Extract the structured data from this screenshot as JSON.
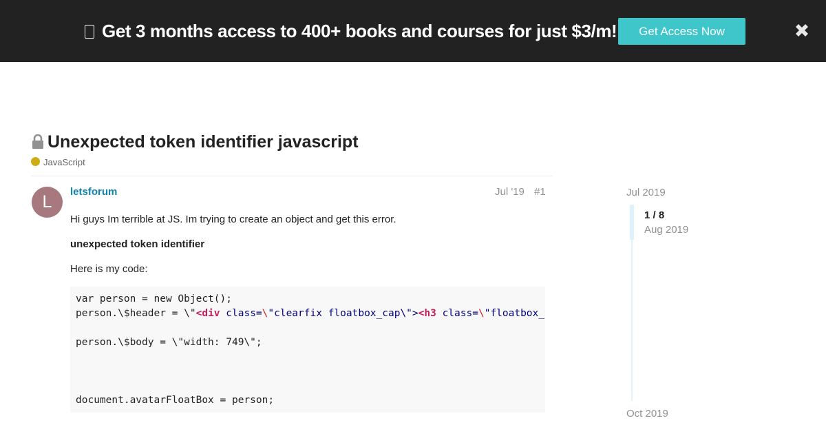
{
  "promo": {
    "emoji_icon": "box-icon",
    "text": "Get 3 months access to 400+ books and courses for just $3/m!",
    "button_label": "Get Access Now",
    "close_icon": "close-icon",
    "bg_color": "#222222",
    "button_color": "#3ec6cb"
  },
  "topic": {
    "title": "Unexpected token identifier javascript",
    "status_icon": "lock-icon",
    "category": "JavaScript",
    "category_color": "#cfac10"
  },
  "post": {
    "avatar_letter": "L",
    "avatar_color": "#a8787f",
    "username": "letsforum",
    "date": "Jul '19",
    "number": "#1",
    "paragraph_1": "Hi guys Im terrible at JS. Im trying to create an object and get this error.",
    "paragraph_2": "unexpected token identifier",
    "paragraph_3": "Here is my code:",
    "code": {
      "line_1": "var person = new Object();",
      "line_2_a": "person.\\$header = \\\"",
      "line_2_b": "<",
      "line_2_c": "div",
      "line_2_d": " class=",
      "line_2_e": "\\",
      "line_2_f": "\"clearfix floatbox_cap\\\">",
      "line_2_g": "<",
      "line_2_h": "h3",
      "line_2_i": " class=",
      "line_2_j": "\\",
      "line_2_k": "\"floatbox_title\\\">",
      "line_3": "",
      "line_4": "person.\\$body = \\\"width: 749\\\";",
      "line_5": "",
      "line_6": "",
      "line_7": "",
      "line_8": "document.avatarFloatBox = person;"
    }
  },
  "timeline": {
    "start": "Jul 2019",
    "position": "1 / 8",
    "current": "Aug 2019",
    "end": "Oct 2019"
  }
}
